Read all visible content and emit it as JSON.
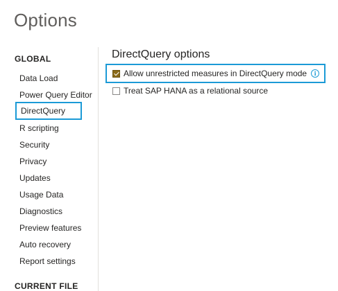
{
  "window": {
    "title": "Options"
  },
  "sidebar": {
    "global_header": "GLOBAL",
    "items": [
      {
        "label": "Data Load"
      },
      {
        "label": "Power Query Editor"
      },
      {
        "label": "DirectQuery",
        "selected": true
      },
      {
        "label": "R scripting"
      },
      {
        "label": "Security"
      },
      {
        "label": "Privacy"
      },
      {
        "label": "Updates"
      },
      {
        "label": "Usage Data"
      },
      {
        "label": "Diagnostics"
      },
      {
        "label": "Preview features"
      },
      {
        "label": "Auto recovery"
      },
      {
        "label": "Report settings"
      }
    ],
    "current_file_header": "CURRENT FILE"
  },
  "main": {
    "section_title": "DirectQuery options",
    "options": [
      {
        "label": "Allow unrestricted measures in DirectQuery mode",
        "checked": true,
        "info_icon": "info-icon"
      },
      {
        "label": "Treat SAP HANA as a relational source",
        "checked": false
      }
    ]
  },
  "colors": {
    "highlight_border": "#1b9ad6",
    "checkbox_checked": "#8a6a19",
    "divider": "#e1dfdd"
  }
}
